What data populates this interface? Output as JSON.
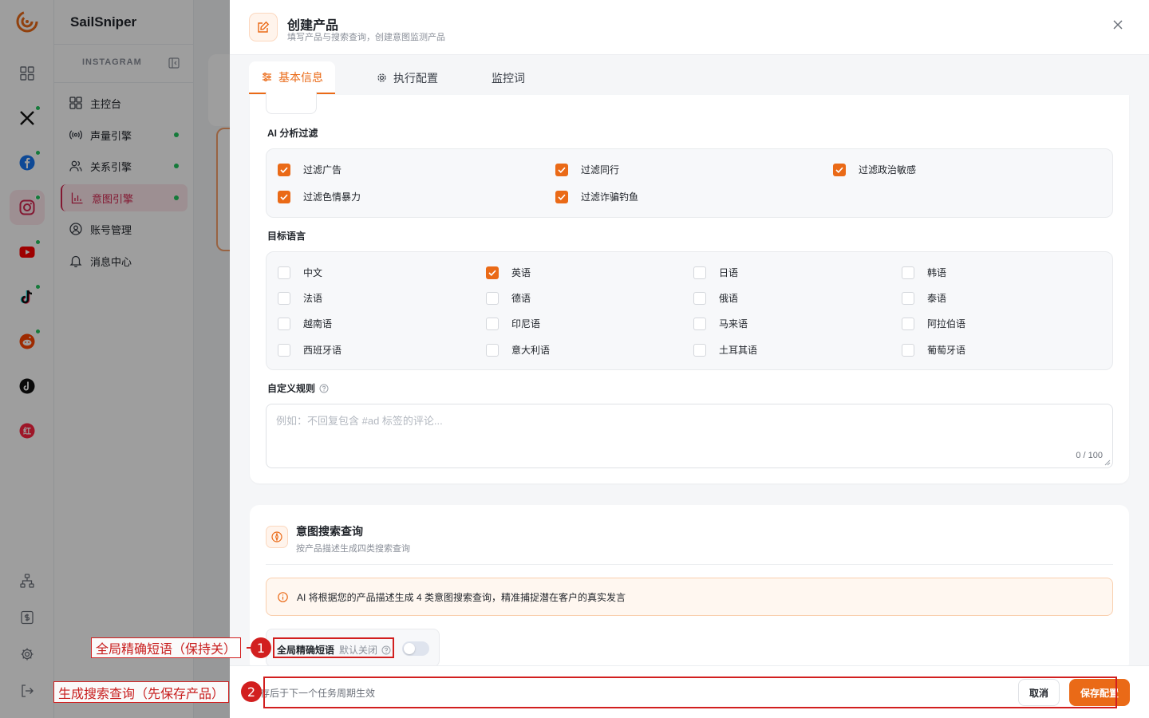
{
  "app": {
    "brand": "SailSniper"
  },
  "rail": {
    "items": [
      {
        "icon": "dashboard-grid-icon",
        "dot": false
      },
      {
        "icon": "x-twitter-icon",
        "dot": true
      },
      {
        "icon": "facebook-icon",
        "dot": true
      },
      {
        "icon": "instagram-icon",
        "dot": true,
        "active": true
      },
      {
        "icon": "youtube-icon",
        "dot": true
      },
      {
        "icon": "tiktok-icon",
        "dot": true
      },
      {
        "icon": "reddit-icon",
        "dot": true
      },
      {
        "icon": "threads-icon",
        "dot": false
      },
      {
        "icon": "xiaohongshu-icon",
        "dot": false,
        "text": "红"
      }
    ],
    "bottom": [
      "org-chart-icon",
      "billing-icon",
      "settings-icon",
      "logout-icon"
    ]
  },
  "sidebar": {
    "section": "INSTAGRAM",
    "items": [
      {
        "label": "主控台",
        "icon": "dashboard-icon",
        "dot": false
      },
      {
        "label": "声量引擎",
        "icon": "broadcast-icon",
        "dot": true
      },
      {
        "label": "关系引擎",
        "icon": "users-icon",
        "dot": true
      },
      {
        "label": "意图引擎",
        "icon": "chart-bars-icon",
        "dot": true,
        "active": true
      },
      {
        "label": "账号管理",
        "icon": "account-icon",
        "dot": false
      },
      {
        "label": "消息中心",
        "icon": "bell-icon",
        "dot": false
      }
    ]
  },
  "drawer": {
    "title": "创建产品",
    "subtitle": "填写产品与搜索查询，创建意图监测产品",
    "tabs": [
      {
        "label": "基本信息",
        "icon": "sliders-icon",
        "active": true
      },
      {
        "label": "执行配置",
        "icon": "gear-icon",
        "active": false
      },
      {
        "label": "监控词",
        "icon": "",
        "active": false
      }
    ],
    "ai_filter": {
      "label": "AI 分析过滤",
      "options": [
        {
          "label": "过滤广告",
          "checked": true
        },
        {
          "label": "过滤同行",
          "checked": true
        },
        {
          "label": "过滤政治敏感",
          "checked": true
        },
        {
          "label": "过滤色情暴力",
          "checked": true
        },
        {
          "label": "过滤诈骗钓鱼",
          "checked": true
        }
      ]
    },
    "languages": {
      "label": "目标语言",
      "options": [
        {
          "label": "中文",
          "checked": false
        },
        {
          "label": "英语",
          "checked": true
        },
        {
          "label": "日语",
          "checked": false
        },
        {
          "label": "韩语",
          "checked": false
        },
        {
          "label": "法语",
          "checked": false
        },
        {
          "label": "德语",
          "checked": false
        },
        {
          "label": "俄语",
          "checked": false
        },
        {
          "label": "泰语",
          "checked": false
        },
        {
          "label": "越南语",
          "checked": false
        },
        {
          "label": "印尼语",
          "checked": false
        },
        {
          "label": "马来语",
          "checked": false
        },
        {
          "label": "阿拉伯语",
          "checked": false
        },
        {
          "label": "西班牙语",
          "checked": false
        },
        {
          "label": "意大利语",
          "checked": false
        },
        {
          "label": "土耳其语",
          "checked": false
        },
        {
          "label": "葡萄牙语",
          "checked": false
        }
      ]
    },
    "custom_rules": {
      "label": "自定义规则",
      "placeholder": "例如：不回复包含 #ad 标签的评论...",
      "value": "",
      "counter": "0 / 100"
    },
    "intent_query": {
      "title": "意图搜索查询",
      "subtitle": "按产品描述生成四类搜索查询",
      "info": "AI 将根据您的产品描述生成 4 类意图搜索查询，精准捕捉潜在客户的真实发言",
      "toggle_label": "全局精确短语",
      "toggle_hint": "默认关闭",
      "toggle_on": false
    },
    "footer": {
      "note": "存后于下一个任务周期生效",
      "cancel": "取消",
      "save": "保存配置"
    }
  },
  "annotations": [
    {
      "num": "1",
      "text": "全局精确短语（保持关）"
    },
    {
      "num": "2",
      "text": "生成搜索查询（先保存产品）"
    }
  ],
  "colors": {
    "accent": "#ea6a17",
    "annotation": "#d21f1f",
    "active_nav": "#d4264f"
  }
}
